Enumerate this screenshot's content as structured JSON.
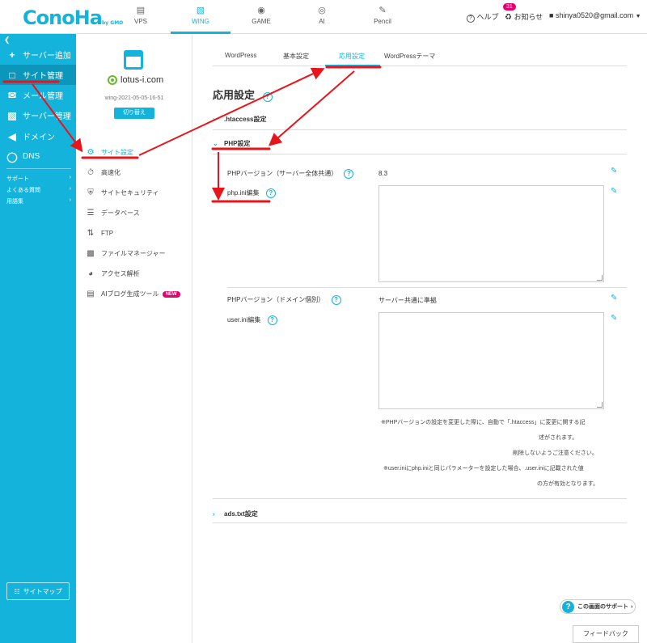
{
  "header": {
    "logo_main": "ConoHa",
    "logo_sub": "by GMO",
    "nav": [
      {
        "label": "VPS",
        "icon": "server-icon"
      },
      {
        "label": "WING",
        "icon": "wing-icon",
        "active": true
      },
      {
        "label": "GAME",
        "icon": "gamepad-icon"
      },
      {
        "label": "AI",
        "icon": "ai-icon"
      },
      {
        "label": "Pencil",
        "icon": "pencil-doc-icon"
      }
    ],
    "help_label": "ヘルプ",
    "notifications_label": "お知らせ",
    "notifications_count": "31",
    "user_email": "shinya0520@gmail.com"
  },
  "sidebar": {
    "collapse_icon": "chevron-left-icon",
    "items": [
      {
        "label": "サーバー追加",
        "icon": "plus-icon"
      },
      {
        "label": "サイト管理",
        "icon": "site-icon",
        "active": true
      },
      {
        "label": "メール管理",
        "icon": "mail-icon"
      },
      {
        "label": "サーバー管理",
        "icon": "server-manage-icon"
      },
      {
        "label": "ドメイン",
        "icon": "domain-icon"
      },
      {
        "label": "DNS",
        "icon": "globe-icon"
      }
    ],
    "small_items": [
      {
        "label": "サポート"
      },
      {
        "label": "よくある質問"
      },
      {
        "label": "用語集"
      }
    ],
    "sitemap_label": "サイトマップ"
  },
  "site_panel": {
    "site_name": "lotus-i.com",
    "site_id": "wing-2021-05-05-16-51",
    "switch_label": "切り替え",
    "menu": [
      {
        "label": "サイト設定",
        "icon": "site-settings-icon",
        "active": true
      },
      {
        "label": "高速化",
        "icon": "stopwatch-icon"
      },
      {
        "label": "サイトセキュリティ",
        "icon": "shield-icon"
      },
      {
        "label": "データベース",
        "icon": "database-icon"
      },
      {
        "label": "FTP",
        "icon": "ftp-icon"
      },
      {
        "label": "ファイルマネージャー",
        "icon": "folder-icon"
      },
      {
        "label": "アクセス解析",
        "icon": "pie-chart-icon"
      },
      {
        "label": "AIブログ生成ツール",
        "icon": "ai-blog-icon",
        "badge": "NEW"
      }
    ]
  },
  "content": {
    "tabs": [
      "WordPress",
      "基本設定",
      "応用設定",
      "WordPressテーマ"
    ],
    "active_tab": "応用設定",
    "title": "応用設定",
    "sections": {
      "htaccess": ".htaccess設定",
      "php": "PHP設定",
      "ads": "ads.txt設定"
    },
    "php": {
      "version_label": "PHPバージョン（サーバー全体共通）",
      "version_value": "8.3",
      "ini_label": "php.ini編集",
      "ini_value": "",
      "domain_version_label": "PHPバージョン（ドメイン個別）",
      "domain_version_value": "サーバー共通に準拠",
      "user_ini_label": "user.ini編集",
      "user_ini_value": ""
    },
    "notes": [
      "※PHPバージョンの設定を変更した際に、自動で「.htaccess」に変更に関する記",
      "述がされます。",
      "削除しないようご注意ください。",
      "※user.iniにphp.iniと同じパラメーターを設定した場合、.user.iniに記載された値",
      "の方が有効となります。"
    ]
  },
  "footer": {
    "support_label": "この画面のサポート",
    "feedback_label": "フィードバック"
  },
  "colors": {
    "accent": "#13b3dc",
    "annotation": "#e8141b",
    "badge": "#e5006e"
  }
}
